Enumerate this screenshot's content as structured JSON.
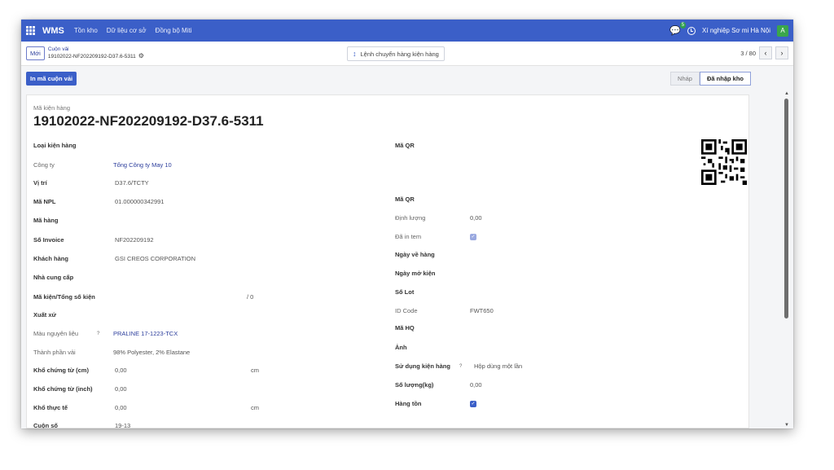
{
  "topnav": {
    "brand": "WMS",
    "menu": [
      "Tồn kho",
      "Dữ liệu cơ sở",
      "Đồng bộ Miti"
    ],
    "chat_badge": "5",
    "company": "Xí nghiệp Sơ mi Hà Nội",
    "avatar_letter": "A"
  },
  "control": {
    "new_label": "Mới",
    "breadcrumb_parent": "Cuộn vải",
    "breadcrumb_current": "19102022-NF202209192-D37.6-5311",
    "action_label": "Lệnh chuyển hàng kiện hàng",
    "pager": "3 / 80"
  },
  "status": {
    "print_label": "In mã cuộn vải",
    "stages": [
      "Nháp",
      "Đã nhập kho"
    ],
    "active_stage": "Đã nhập kho"
  },
  "record": {
    "title_label": "Mã kiện hàng",
    "title": "19102022-NF202209192-D37.6-5311"
  },
  "left_fields": [
    {
      "label": "Loại kiện hàng",
      "value": ""
    },
    {
      "label": "Công ty",
      "value": "Tổng Công ty May 10"
    },
    {
      "label": "Vị trí",
      "value": "D37.6/TCTY"
    },
    {
      "label": "Mã NPL",
      "value": "01.000000342991"
    },
    {
      "label": "Mã hàng",
      "value": ""
    },
    {
      "label": "Số Invoice",
      "value": "NF202209192"
    },
    {
      "label": "Khách hàng",
      "value": "GSI CREOS CORPORATION"
    },
    {
      "label": "Nhà cung cấp",
      "value": ""
    },
    {
      "label": "Mã kiện/Tổng số kiện",
      "value": "",
      "extra": "/  0"
    },
    {
      "label": "Xuất xứ",
      "value": ""
    },
    {
      "label": "Màu nguyên liệu",
      "value": "PRALINE 17-1223-TCX"
    },
    {
      "label": "Thành phần vải",
      "value": "98% Polyester, 2% Elastane"
    },
    {
      "label": "Khổ chứng từ (cm)",
      "value": "0,00",
      "extra": "cm"
    },
    {
      "label": "Khổ chứng từ (inch)",
      "value": "0,00"
    },
    {
      "label": "Khổ thực tế",
      "value": "0,00",
      "extra": "cm"
    },
    {
      "label": "Cuộn số",
      "value": "19-13"
    }
  ],
  "right_fields": [
    {
      "label": "Mã QR",
      "value": ""
    },
    {
      "label": "Mã QR",
      "value": ""
    },
    {
      "label": "Định lượng",
      "value": "0,00"
    },
    {
      "label": "Đã in tem",
      "value": ""
    },
    {
      "label": "Ngày về hàng",
      "value": ""
    },
    {
      "label": "Ngày mở kiện",
      "value": ""
    },
    {
      "label": "Số Lot",
      "value": ""
    },
    {
      "label": "ID Code",
      "value": "FWT650"
    },
    {
      "label": "Mã HQ",
      "value": ""
    },
    {
      "label": "Ảnh",
      "value": ""
    },
    {
      "label": "Sử dụng kiện hàng",
      "value": "Hộp dùng một lần"
    },
    {
      "label": "Số lượng(kg)",
      "value": "0,00"
    },
    {
      "label": "Hàng tồn",
      "value": ""
    }
  ],
  "help_mark": "?",
  "colors": {
    "primary": "#3b5fc8",
    "success": "#3aa64b"
  }
}
